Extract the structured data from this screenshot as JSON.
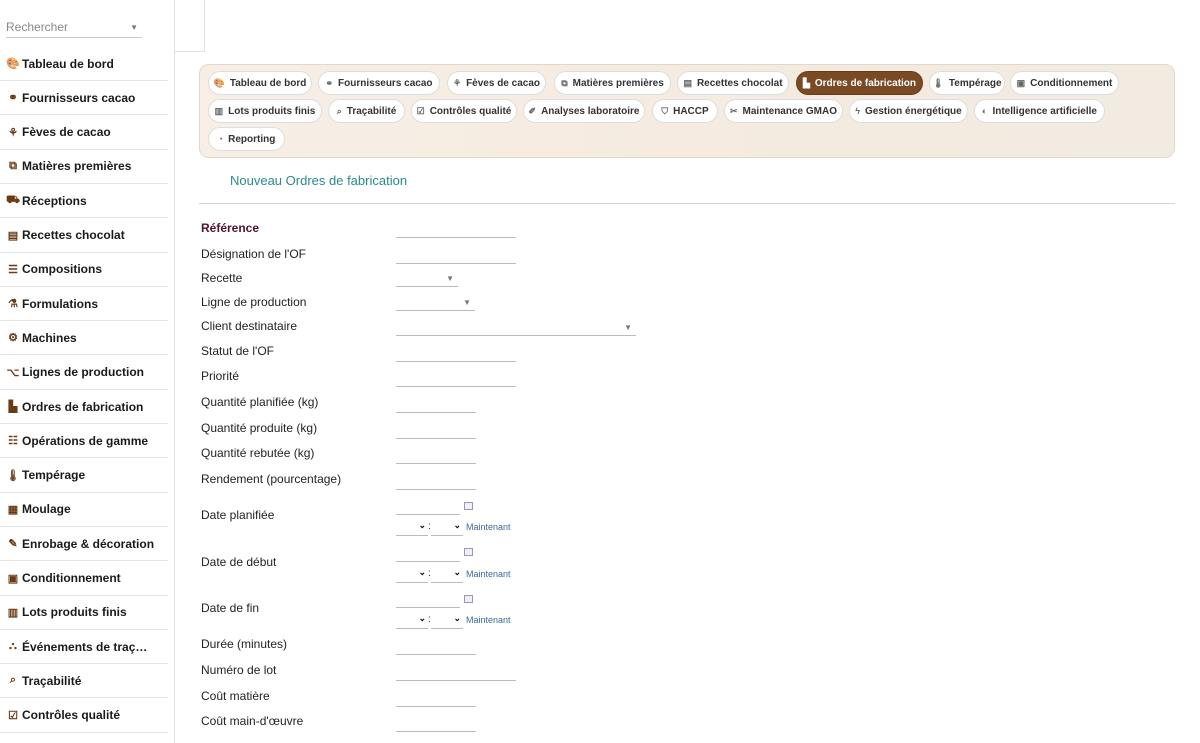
{
  "search": {
    "placeholder": "Rechercher"
  },
  "sidebar": {
    "items": [
      {
        "label": "Tableau de bord",
        "icon": "palette-icon"
      },
      {
        "label": "Fournisseurs cacao",
        "icon": "handshake-icon"
      },
      {
        "label": "Fèves de cacao",
        "icon": "seedling-icon"
      },
      {
        "label": "Matières premières",
        "icon": "cubes-icon"
      },
      {
        "label": "Réceptions",
        "icon": "truck-icon"
      },
      {
        "label": "Recettes chocolat",
        "icon": "book-icon"
      },
      {
        "label": "Compositions",
        "icon": "list-icon"
      },
      {
        "label": "Formulations",
        "icon": "flask-icon"
      },
      {
        "label": "Machines",
        "icon": "cogs-icon"
      },
      {
        "label": "Lignes de production",
        "icon": "sitemap-icon"
      },
      {
        "label": "Ordres de fabrication",
        "icon": "industry-icon"
      },
      {
        "label": "Opérations de gamme",
        "icon": "tasks-icon"
      },
      {
        "label": "Tempérage",
        "icon": "thermometer-icon"
      },
      {
        "label": "Moulage",
        "icon": "grid-icon"
      },
      {
        "label": "Enrobage & décoration",
        "icon": "paint-icon"
      },
      {
        "label": "Conditionnement",
        "icon": "box-icon"
      },
      {
        "label": "Lots produits finis",
        "icon": "barcode-icon"
      },
      {
        "label": "Événements de traç…",
        "icon": "network-icon"
      },
      {
        "label": "Traçabilité",
        "icon": "search-icon"
      },
      {
        "label": "Contrôles qualité",
        "icon": "clipboard-check-icon"
      }
    ]
  },
  "tabs": [
    {
      "label": "Tableau de bord",
      "icon": "palette-icon",
      "active": false
    },
    {
      "label": "Fournisseurs cacao",
      "icon": "handshake-icon",
      "active": false
    },
    {
      "label": "Fèves de cacao",
      "icon": "seedling-icon",
      "active": false
    },
    {
      "label": "Matières premières",
      "icon": "cubes-icon",
      "active": false
    },
    {
      "label": "Recettes chocolat",
      "icon": "book-icon",
      "active": false
    },
    {
      "label": "Ordres de fabrication",
      "icon": "industry-icon",
      "active": true
    },
    {
      "label": "Tempérage",
      "icon": "thermometer-icon",
      "active": false
    },
    {
      "label": "Conditionnement",
      "icon": "box-icon",
      "active": false
    },
    {
      "label": "Lots produits finis",
      "icon": "barcode-icon",
      "active": false
    },
    {
      "label": "Traçabilité",
      "icon": "search-icon",
      "active": false
    },
    {
      "label": "Contrôles qualité",
      "icon": "clipboard-check-icon",
      "active": false
    },
    {
      "label": "Analyses laboratoire",
      "icon": "eyedropper-icon",
      "active": false
    },
    {
      "label": "HACCP",
      "icon": "shield-icon",
      "active": false
    },
    {
      "label": "Maintenance GMAO",
      "icon": "tools-icon",
      "active": false
    },
    {
      "label": "Gestion énergétique",
      "icon": "bolt-icon",
      "active": false
    },
    {
      "label": "Intelligence artificielle",
      "icon": "brain-icon",
      "active": false
    },
    {
      "label": "Reporting",
      "icon": "chart-pie-icon",
      "active": false
    }
  ],
  "form": {
    "title": "Nouveau Ordres de fabrication",
    "fields": {
      "reference": "Référence",
      "designation": "Désignation de l'OF",
      "recette": "Recette",
      "ligne": "Ligne de production",
      "client": "Client destinataire",
      "statut": "Statut de l'OF",
      "priorite": "Priorité",
      "qte_planifiee": "Quantité planifiée (kg)",
      "qte_produite": "Quantité produite (kg)",
      "qte_rebutee": "Quantité rebutée (kg)",
      "rendement": "Rendement (pourcentage)",
      "date_planifiee": "Date planifiée",
      "date_debut": "Date de début",
      "date_fin": "Date de fin",
      "duree": "Durée (minutes)",
      "numero_lot": "Numéro de lot",
      "cout_matiere": "Coût matière",
      "cout_mo": "Coût main-d'œuvre"
    },
    "now_label": "Maintenant",
    "time_separator": ":"
  },
  "colors": {
    "accent": "#2a8a8f",
    "active_tab": "#7a4a25",
    "icon_brown": "#6b3a12",
    "required_label": "#55112b"
  }
}
